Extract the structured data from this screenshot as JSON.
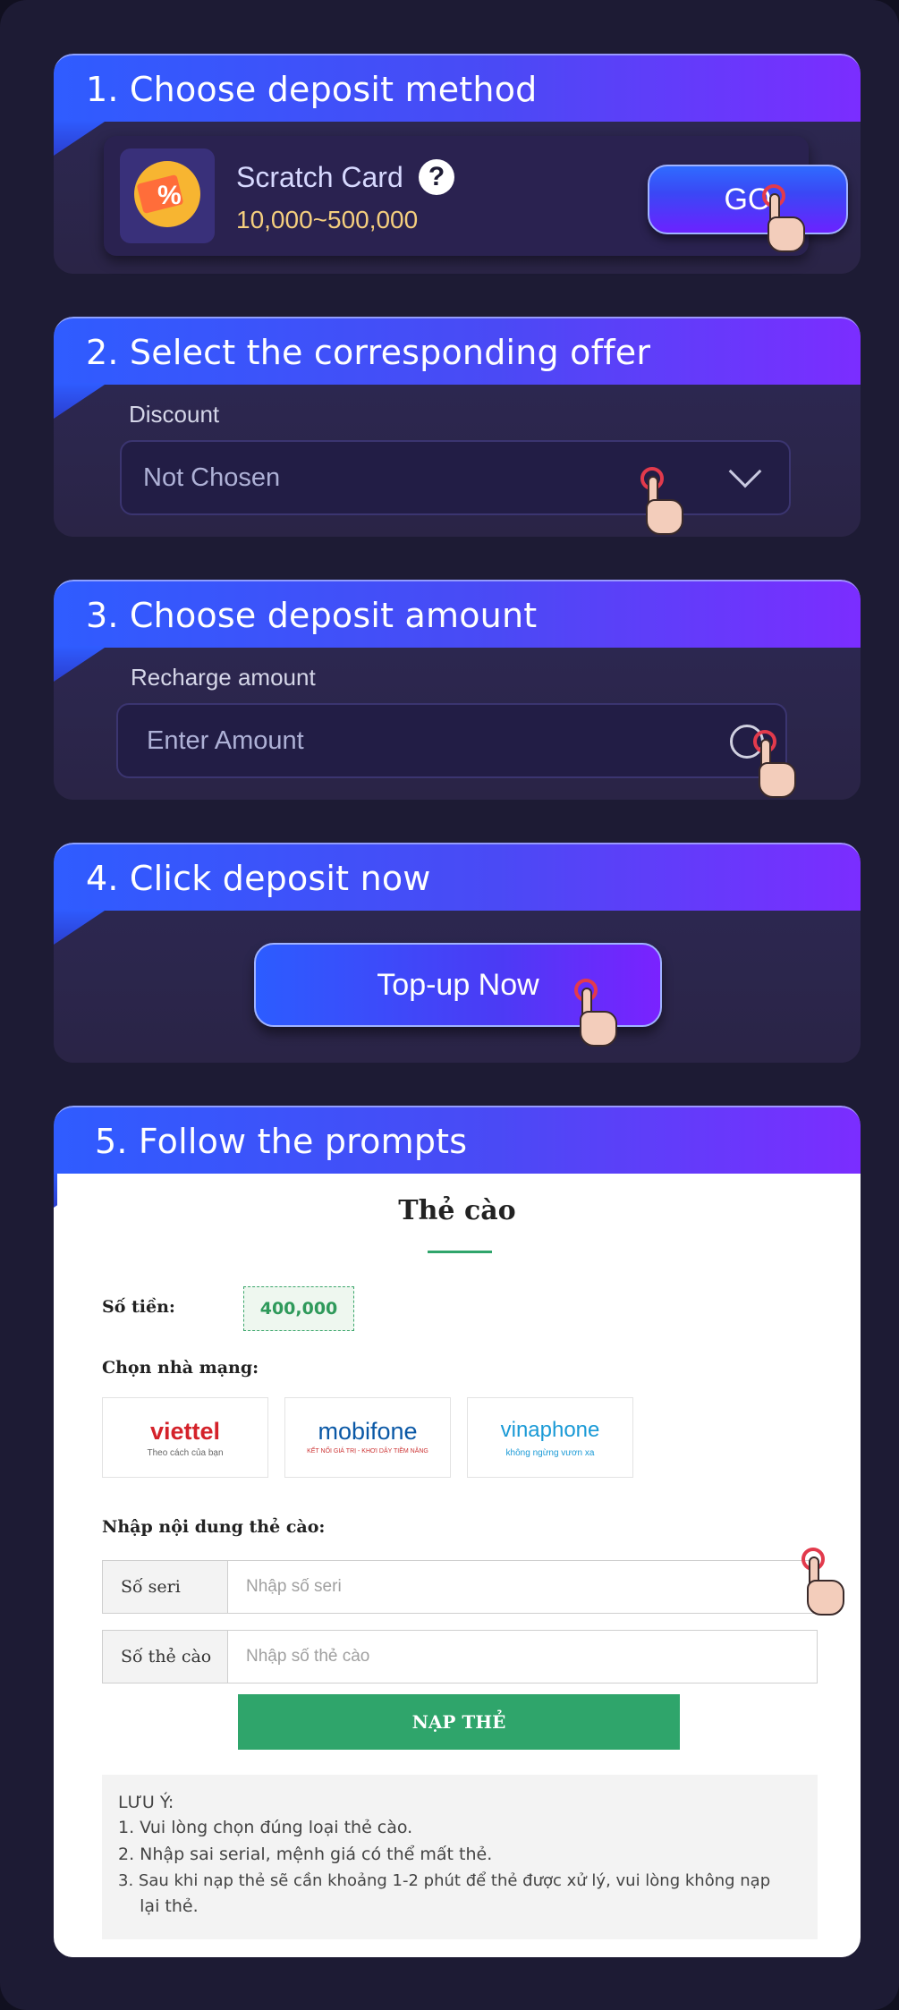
{
  "steps": [
    {
      "title": "1. Choose deposit method"
    },
    {
      "title": "2. Select the corresponding offer"
    },
    {
      "title": "3. Choose deposit amount"
    },
    {
      "title": "4. Click deposit now"
    },
    {
      "title": "5.  Follow the prompts"
    }
  ],
  "method": {
    "name": "Scratch Card",
    "range": "10,000~500,000",
    "go_label": "GO",
    "help_symbol": "?",
    "icon": "ticket-percent-icon"
  },
  "offer": {
    "label": "Discount",
    "value": "Not Chosen"
  },
  "amount": {
    "label": "Recharge amount",
    "placeholder": "Enter Amount"
  },
  "topup": {
    "label": "Top-up Now"
  },
  "form": {
    "title": "Thẻ cào",
    "amount_label": "Số tiền:",
    "amount_value": "400,000",
    "carrier_label": "Chọn nhà mạng:",
    "carriers": [
      {
        "name": "viettel",
        "tagline": "Theo cách của bạn",
        "color": "#d4222a"
      },
      {
        "name": "mobifone",
        "tagline": "KẾT NỐI GIÁ TRỊ - KHƠI DẬY TIỀM NĂNG",
        "color": "#0a58a6"
      },
      {
        "name": "vinaphone",
        "tagline": "không ngừng vươn xa",
        "color": "#1a9ad6"
      }
    ],
    "content_label": "Nhập nội dung thẻ cào:",
    "serial_tag": "Số seri",
    "serial_placeholder": "Nhập số seri",
    "card_tag": "Số thẻ cào",
    "card_placeholder": "Nhập số thẻ cào",
    "submit_label": "NẠP THẺ",
    "notes": [
      "LƯU Ý:",
      "1. Vui lòng chọn đúng loại thẻ cào.",
      "2. Nhập sai serial, mệnh giá có thể mất thẻ.",
      "3. Sau khi nạp thẻ sẽ cần khoảng 1-2 phút để thẻ được xử lý, vui lòng không nạp",
      "    lại thẻ."
    ]
  },
  "colors": {
    "accent_blue": "#2f5cff",
    "accent_purple": "#7b2dff",
    "success_green": "#2fa56b",
    "background": "#1d1b34"
  }
}
